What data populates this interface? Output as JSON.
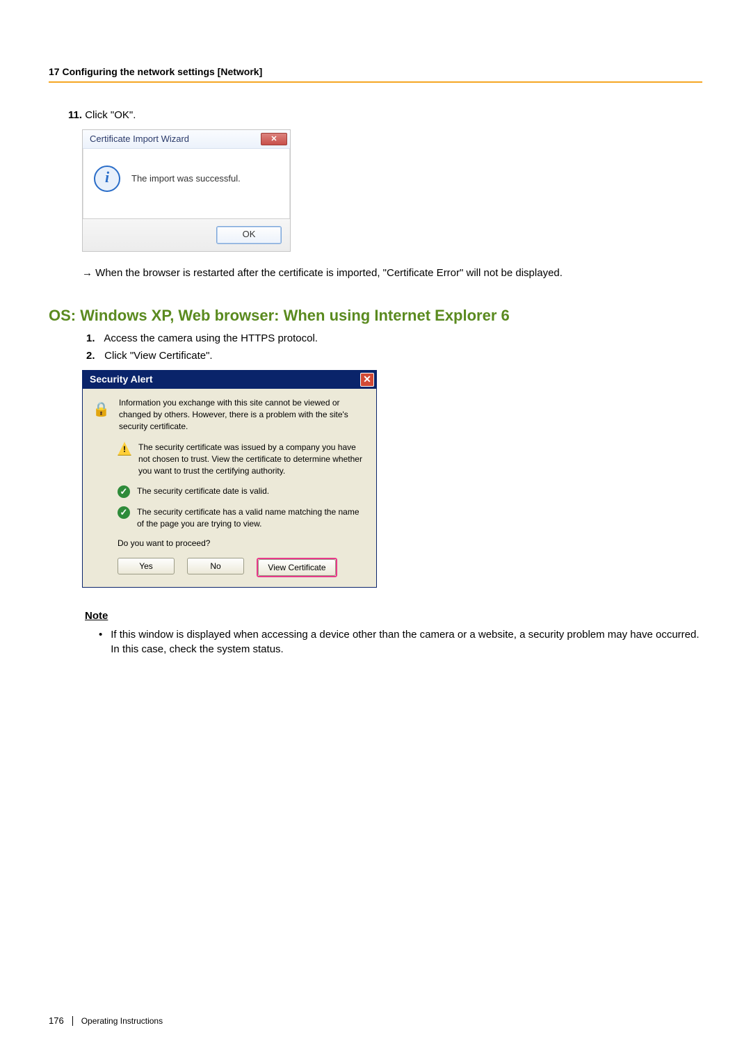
{
  "header": "17 Configuring the network settings [Network]",
  "step11": {
    "number": "11.",
    "text": "Click \"OK\"."
  },
  "dialog1": {
    "title": "Certificate Import Wizard",
    "message": "The import was successful.",
    "ok": "OK",
    "close": "✕"
  },
  "arrowLine": "→   When the browser is restarted after the certificate is imported, \"Certificate Error\" will not be displayed.",
  "h2": "OS: Windows XP, Web browser: When using Internet Explorer 6",
  "olSteps": [
    {
      "num": "1.",
      "text": "Access the camera using the HTTPS protocol."
    },
    {
      "num": "2.",
      "text": "Click \"View Certificate\"."
    }
  ],
  "dialog2": {
    "title": "Security Alert",
    "close": "✕",
    "intro": "Information you exchange with this site cannot be viewed or changed by others. However, there is a problem with the site's security certificate.",
    "warn": "The security certificate was issued by a company you have not chosen to trust. View the certificate to determine whether you want to trust the certifying authority.",
    "check1": "The security certificate date is valid.",
    "check2": "The security certificate has a valid name matching the name of the page you are trying to view.",
    "question": "Do you want to proceed?",
    "btnYes": "Yes",
    "btnNo": "No",
    "btnView": "View Certificate"
  },
  "note": {
    "heading": "Note",
    "bullet": "If this window is displayed when accessing a device other than the camera or a website, a security problem may have occurred. In this case, check the system status."
  },
  "footer": {
    "page": "176",
    "label": "Operating Instructions"
  }
}
